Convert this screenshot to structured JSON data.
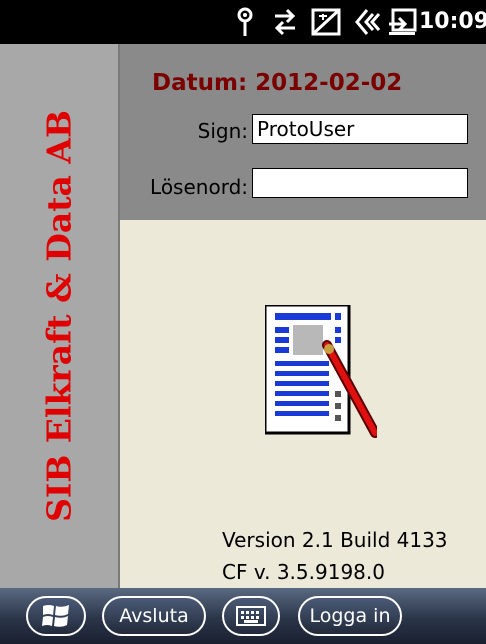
{
  "status": {
    "time": "10:09",
    "icons": [
      "antenna-icon",
      "data-transfer-icon",
      "no-signal-icon",
      "speaker-icon",
      "battery-icon"
    ]
  },
  "sidebar": {
    "company": "SIB Elkraft & Data AB"
  },
  "header": {
    "date": "Datum: 2012-02-02",
    "sign_label": "Sign:",
    "sign_value": "ProtoUser",
    "password_label": "Lösenord:",
    "password_value": ""
  },
  "app_icon": "document-pen-icon",
  "version": {
    "build": "Version 2.1 Build 4133",
    "cf": "CF v. 3.5.9198.0"
  },
  "taskbar": {
    "start_icon": "windows-start-icon",
    "exit_label": "Avsluta",
    "keyboard_icon": "keyboard-icon",
    "login_label": "Logga in"
  },
  "colors": {
    "company_text": "#e00000",
    "date_text": "#7a0000",
    "header_bg": "#8a8a8a",
    "content_bg": "#ece9d8"
  }
}
